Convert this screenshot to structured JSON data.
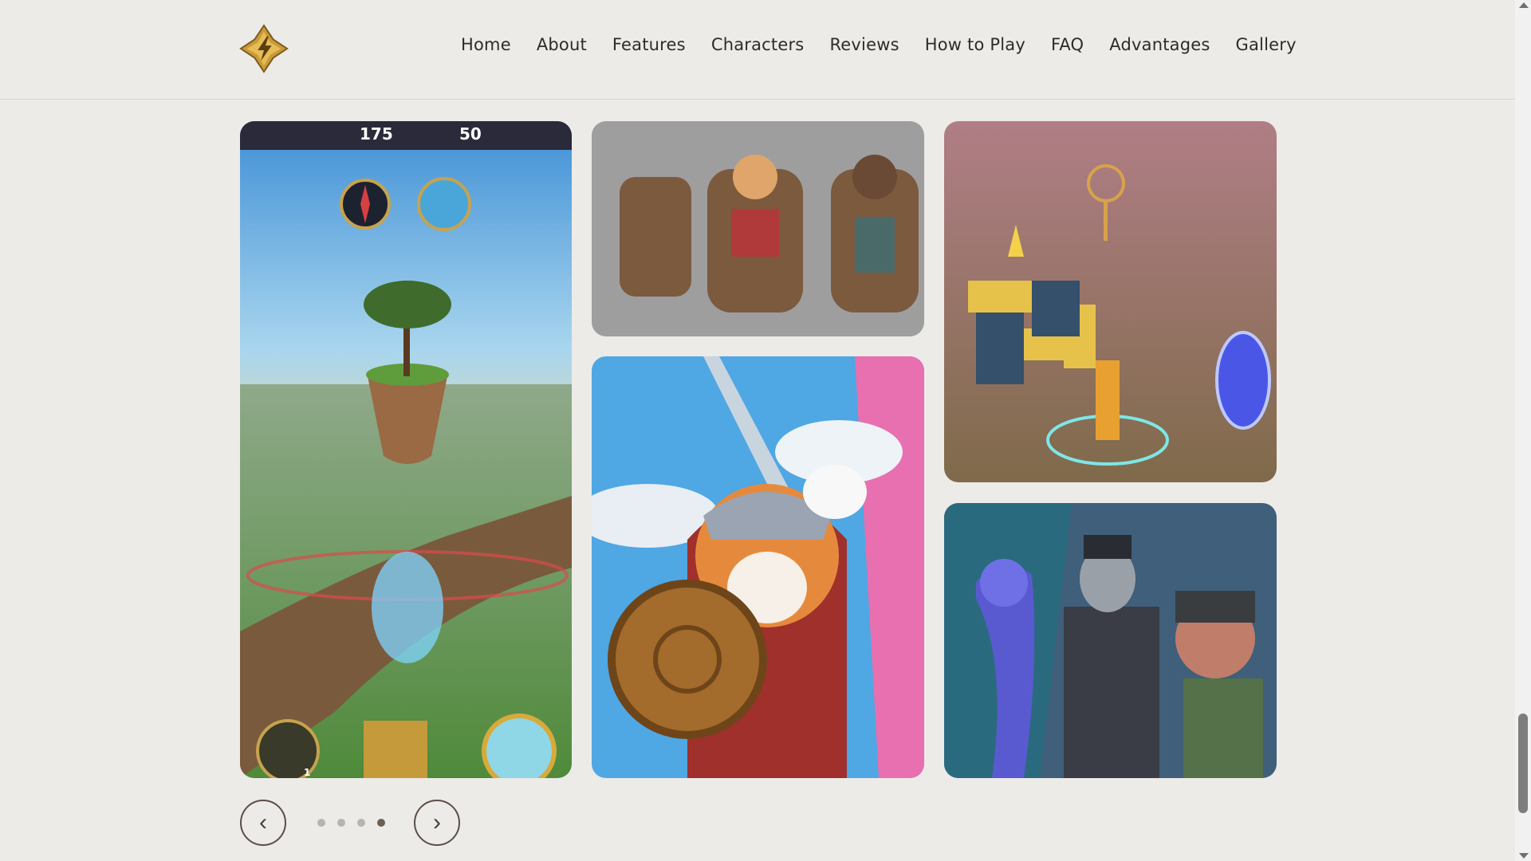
{
  "header": {
    "logo_icon": "diamond-lightning-emblem-icon",
    "nav": [
      "Home",
      "About",
      "Features",
      "Characters",
      "Reviews",
      "How to Play",
      "FAQ",
      "Advantages",
      "Gallery"
    ]
  },
  "gallery": {
    "tiles": [
      {
        "icon": "gameplay-map-screenshot",
        "hud": {
          "coins": "175",
          "gems": "50",
          "level": "1"
        }
      },
      {
        "icon": "corgi-warrior-character-sheet"
      },
      {
        "icon": "ruins-portal-scene"
      },
      {
        "icon": "corgi-knight-illustration"
      },
      {
        "icon": "villains-group-illustration"
      }
    ],
    "pagination": {
      "total": 4,
      "active": 4
    },
    "prev_icon": "chevron-left-icon",
    "next_icon": "chevron-right-icon",
    "prev_glyph": "‹",
    "next_glyph": "›"
  },
  "colors": {
    "background": "#ecebe8",
    "accent": "#5a4e47"
  }
}
